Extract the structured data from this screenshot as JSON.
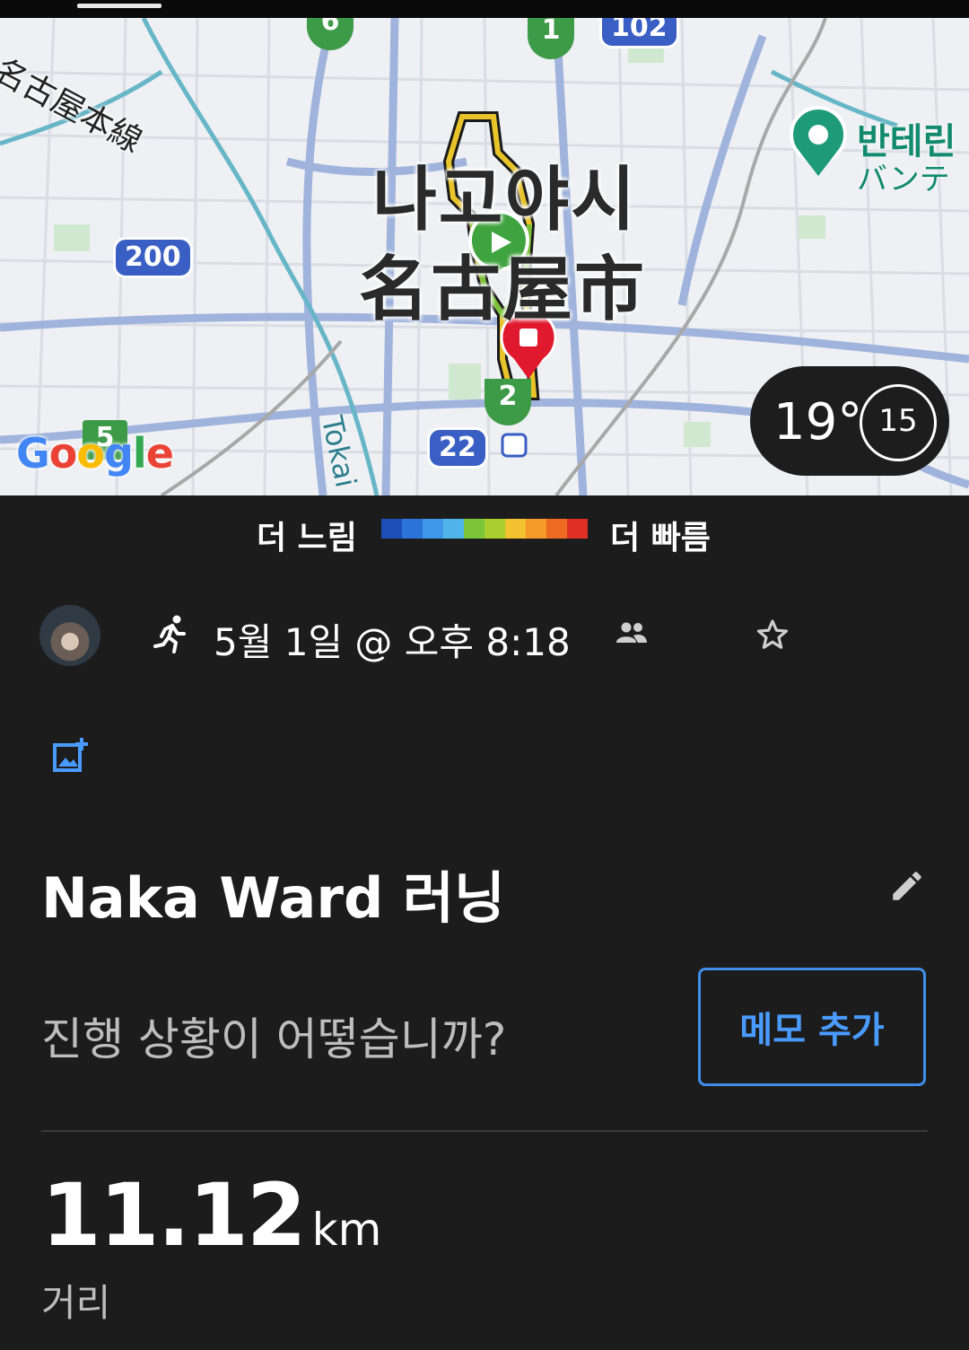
{
  "map": {
    "city_ko": "나고야시",
    "city_ja": "名古屋市",
    "rail_line": "名古屋本線",
    "tokai": "Tokai",
    "place_ko": "반테린",
    "place_ja": "バンテ",
    "shields": {
      "r200": "200",
      "r22": "22",
      "r102": "102",
      "r5": "5",
      "g1": "1",
      "g2": "2",
      "g6": "6"
    },
    "google": [
      "G",
      "o",
      "o",
      "g",
      "l",
      "e"
    ]
  },
  "weather": {
    "temp": "19°",
    "dial": "15"
  },
  "pace_legend": {
    "slow_label": "더 느림",
    "fast_label": "더 빠름",
    "colors": [
      "#1e4fb8",
      "#2b73d8",
      "#3f97ea",
      "#4fb4e8",
      "#7cc43a",
      "#a9cf2e",
      "#f2c230",
      "#f59a2a",
      "#ee6a22",
      "#e03025"
    ]
  },
  "activity": {
    "date": "5월 1일 @ 오후 8:18",
    "icons": [
      "run-icon",
      "group-icon",
      "star-icon"
    ]
  },
  "title": "Naka Ward 러닝",
  "note": {
    "prompt": "진행 상황이 어떻습니까?",
    "button": "메모 추가"
  },
  "stat": {
    "value": "11.12",
    "unit": "km",
    "label": "거리"
  }
}
